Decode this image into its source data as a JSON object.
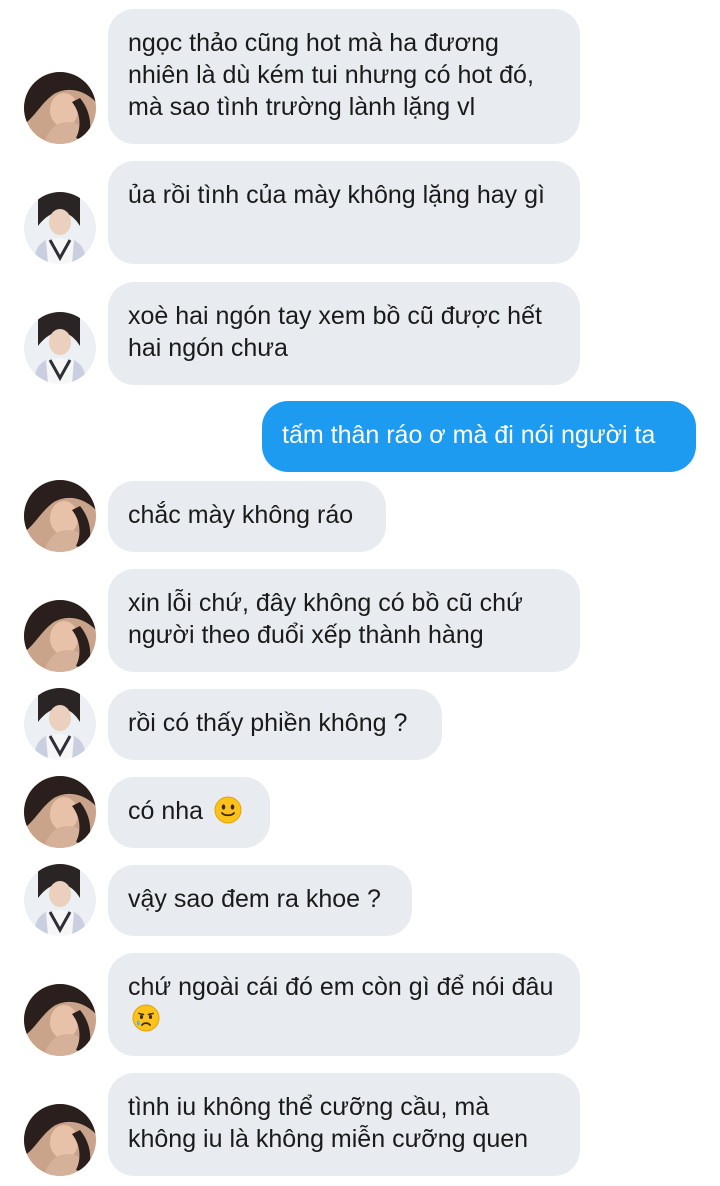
{
  "conversation": {
    "messages": [
      {
        "sender": "other",
        "avatar": "girl-selfie",
        "text": "ngọc thảo cũng hot mà ha đương nhiên là dù kém tui nhưng có hot đó, mà sao tình trường lành lặng vl"
      },
      {
        "sender": "other",
        "avatar": "girl-uniform",
        "text": "ủa rồi tình của mày không lặng hay gì"
      },
      {
        "sender": "other",
        "avatar": "girl-uniform",
        "text": "xoè hai ngón tay xem bồ cũ được hết hai ngón chưa"
      },
      {
        "sender": "me",
        "text": "tấm thân ráo ơ mà đi nói người ta"
      },
      {
        "sender": "other",
        "avatar": "girl-selfie",
        "text": "chắc mày không ráo"
      },
      {
        "sender": "other",
        "avatar": "girl-selfie",
        "text": "xin lỗi chứ, đây không có bồ cũ chứ người theo đuổi xếp thành hàng"
      },
      {
        "sender": "other",
        "avatar": "girl-uniform",
        "text": "rồi có thấy phiền không ?"
      },
      {
        "sender": "other",
        "avatar": "girl-selfie",
        "text": "có nha",
        "emoji": "slightly-smiling-face"
      },
      {
        "sender": "other",
        "avatar": "girl-uniform",
        "text": "vậy sao đem ra khoe ?"
      },
      {
        "sender": "other",
        "avatar": "girl-selfie",
        "text": "chứ ngoài cái đó em còn gì để nói đâu",
        "emoji": "crying-face"
      },
      {
        "sender": "other",
        "avatar": "girl-selfie",
        "text": "tình iu không thể cưỡng cầu, mà không iu là không miễn cưỡng quen"
      }
    ]
  },
  "colors": {
    "incoming_bubble": "#e8ecf0",
    "outgoing_bubble": "#1d9bf0",
    "text": "#1a1a1a",
    "background": "#ffffff"
  }
}
